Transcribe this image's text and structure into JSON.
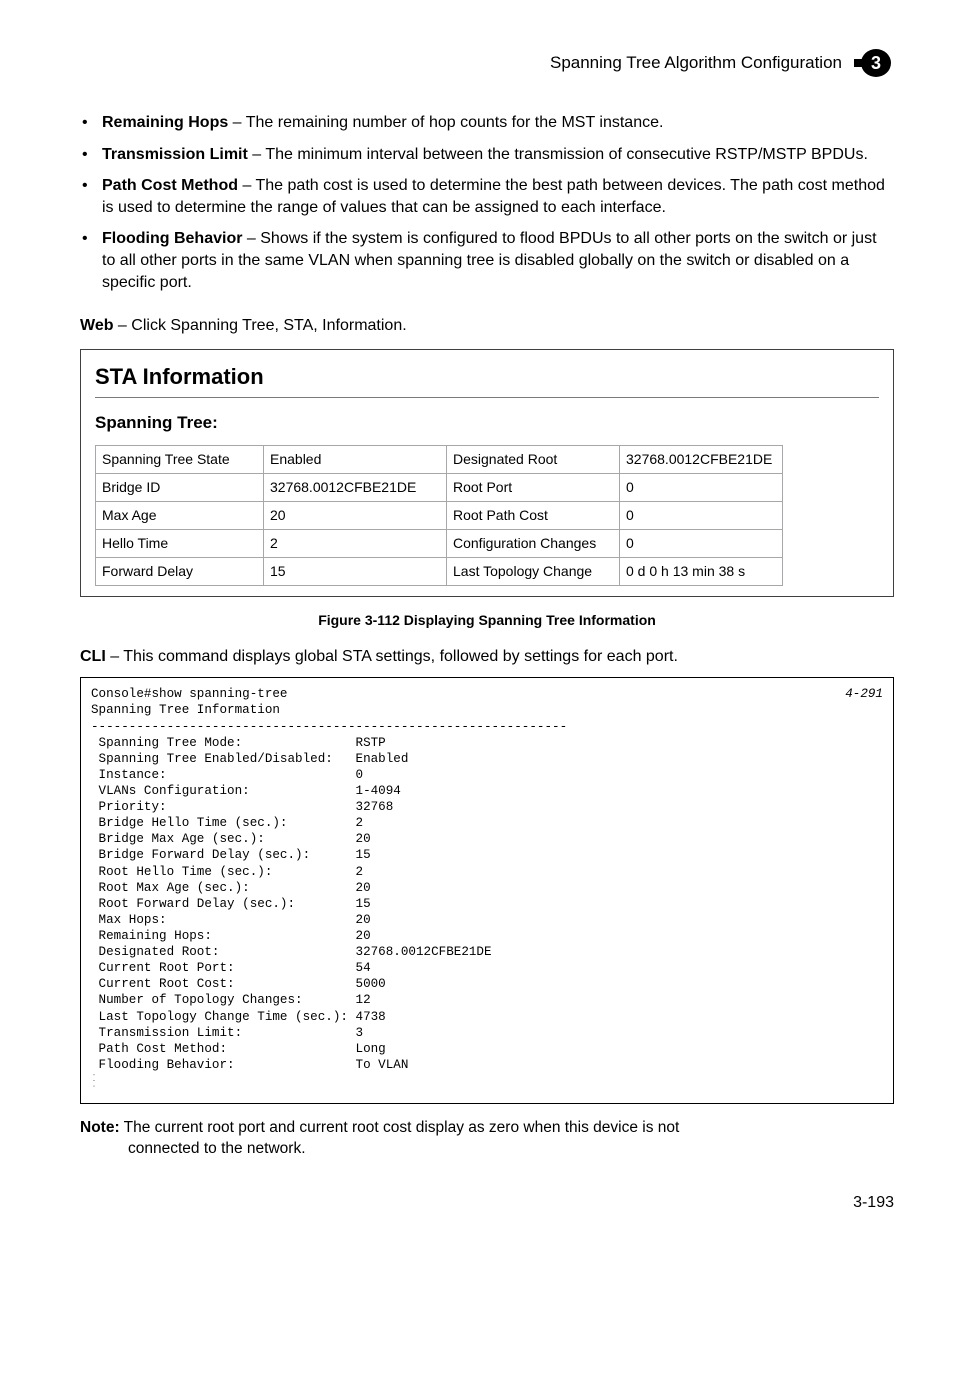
{
  "header": {
    "running_title": "Spanning Tree Algorithm Configuration",
    "chapter_number": "3"
  },
  "bullets": [
    {
      "term": "Remaining Hops",
      "desc": " – The remaining number of hop counts for the MST instance."
    },
    {
      "term": "Transmission Limit",
      "desc": " – The minimum interval between the transmission of consecutive RSTP/MSTP BPDUs."
    },
    {
      "term": "Path Cost Method",
      "desc": " – The path cost is used to determine the best path between devices. The path cost method is used to determine the range of values that can be assigned to each interface."
    },
    {
      "term": "Flooding Behavior",
      "desc": " – Shows if the system is configured to flood BPDUs to all other ports on the switch or just to all other ports in the same VLAN when spanning tree is disabled globally on the switch or disabled on a specific port."
    }
  ],
  "web_line": {
    "label": "Web",
    "rest": " – Click Spanning Tree, STA, Information."
  },
  "sta": {
    "title": "STA Information",
    "subtitle": "Spanning Tree:",
    "rows": [
      [
        "Spanning Tree State",
        "Enabled",
        "Designated Root",
        "32768.0012CFBE21DE"
      ],
      [
        "Bridge ID",
        "32768.0012CFBE21DE",
        "Root Port",
        "0"
      ],
      [
        "Max Age",
        "20",
        "Root Path Cost",
        "0"
      ],
      [
        "Hello Time",
        "2",
        "Configuration Changes",
        "0"
      ],
      [
        "Forward Delay",
        "15",
        "Last Topology Change",
        "0 d 0 h 13 min 38 s"
      ]
    ]
  },
  "figure_caption": "Figure 3-112  Displaying Spanning Tree Information",
  "cli_line": {
    "label": "CLI",
    "rest": " – This command displays global STA settings, followed by settings for each port."
  },
  "console": {
    "cross_ref": "4-291",
    "cmd": "Console#show spanning-tree",
    "title_line": "Spanning Tree Information",
    "sep": "---------------------------------------------------------------",
    "lines": [
      [
        "Spanning Tree Mode:",
        "RSTP"
      ],
      [
        "Spanning Tree Enabled/Disabled:",
        "Enabled"
      ],
      [
        "Instance:",
        "0"
      ],
      [
        "VLANs Configuration:",
        "1-4094"
      ],
      [
        "Priority:",
        "32768"
      ],
      [
        "Bridge Hello Time (sec.):",
        "2"
      ],
      [
        "Bridge Max Age (sec.):",
        "20"
      ],
      [
        "Bridge Forward Delay (sec.):",
        "15"
      ],
      [
        "Root Hello Time (sec.):",
        "2"
      ],
      [
        "Root Max Age (sec.):",
        "20"
      ],
      [
        "Root Forward Delay (sec.):",
        "15"
      ],
      [
        "Max Hops:",
        "20"
      ],
      [
        "Remaining Hops:",
        "20"
      ],
      [
        "Designated Root:",
        "32768.0012CFBE21DE"
      ],
      [
        "Current Root Port:",
        "54"
      ],
      [
        "Current Root Cost:",
        "5000"
      ],
      [
        "Number of Topology Changes:",
        "12"
      ],
      [
        "Last Topology Change Time (sec.):",
        "4738"
      ],
      [
        "Transmission Limit:",
        "3"
      ],
      [
        "Path Cost Method:",
        "Long"
      ],
      [
        "Flooding Behavior:",
        "To VLAN"
      ]
    ],
    "ellipsis": "..."
  },
  "note": {
    "label": "Note:",
    "line1": "The current root port and current root cost display as zero when this device is not",
    "line2": "connected to the network."
  },
  "page_number": "3-193"
}
